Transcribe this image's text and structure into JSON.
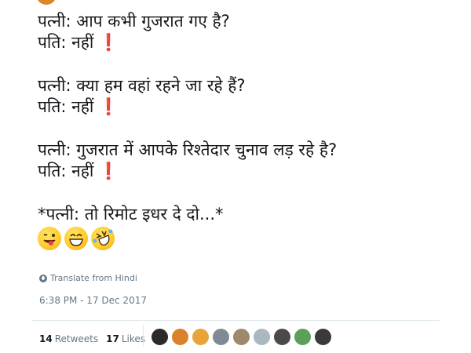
{
  "tweet": {
    "lines": [
      [
        "पत्नी: आप कभी गुजरात गए है?",
        "पति: नहीं"
      ],
      [
        "पत्नी: क्या हम वहां रहने जा रहे हैं?",
        "पति: नहीं"
      ],
      [
        "पत्नी: गुजरात में आपके  रिश्तेदार चुनाव लड़ रहे है?",
        "पति: नहीं"
      ]
    ],
    "exclamation": "❗",
    "punchline": "*पत्नी: तो रिमोट इधर दे दो...*",
    "emojis": [
      "winking-tongue-emoji",
      "grinning-emoji",
      "rolling-laughing-emoji"
    ]
  },
  "translate_label": "Translate from Hindi",
  "timestamp": "6:38 PM - 17 Dec 2017",
  "stats": {
    "retweets_count": "14",
    "retweets_label": "Retweets",
    "likes_count": "17",
    "likes_label": "Likes"
  },
  "likers": [
    {
      "name": "liker-avatar-1",
      "color": "#2b2b2b"
    },
    {
      "name": "liker-avatar-2",
      "color": "#d9822b"
    },
    {
      "name": "liker-avatar-3",
      "color": "#e8a33a"
    },
    {
      "name": "liker-avatar-4",
      "color": "#7f8a94"
    },
    {
      "name": "liker-avatar-5",
      "color": "#9c8a6a"
    },
    {
      "name": "liker-avatar-6",
      "color": "#aab8c2"
    },
    {
      "name": "liker-avatar-7",
      "color": "#4a4a4a"
    },
    {
      "name": "liker-avatar-8",
      "color": "#5aa05a"
    },
    {
      "name": "liker-avatar-9",
      "color": "#3a3a3a"
    }
  ],
  "colors": {
    "accent_exclamation": "#d4202a",
    "meta_text": "#657786",
    "avatar_peek": "#e0842a"
  }
}
